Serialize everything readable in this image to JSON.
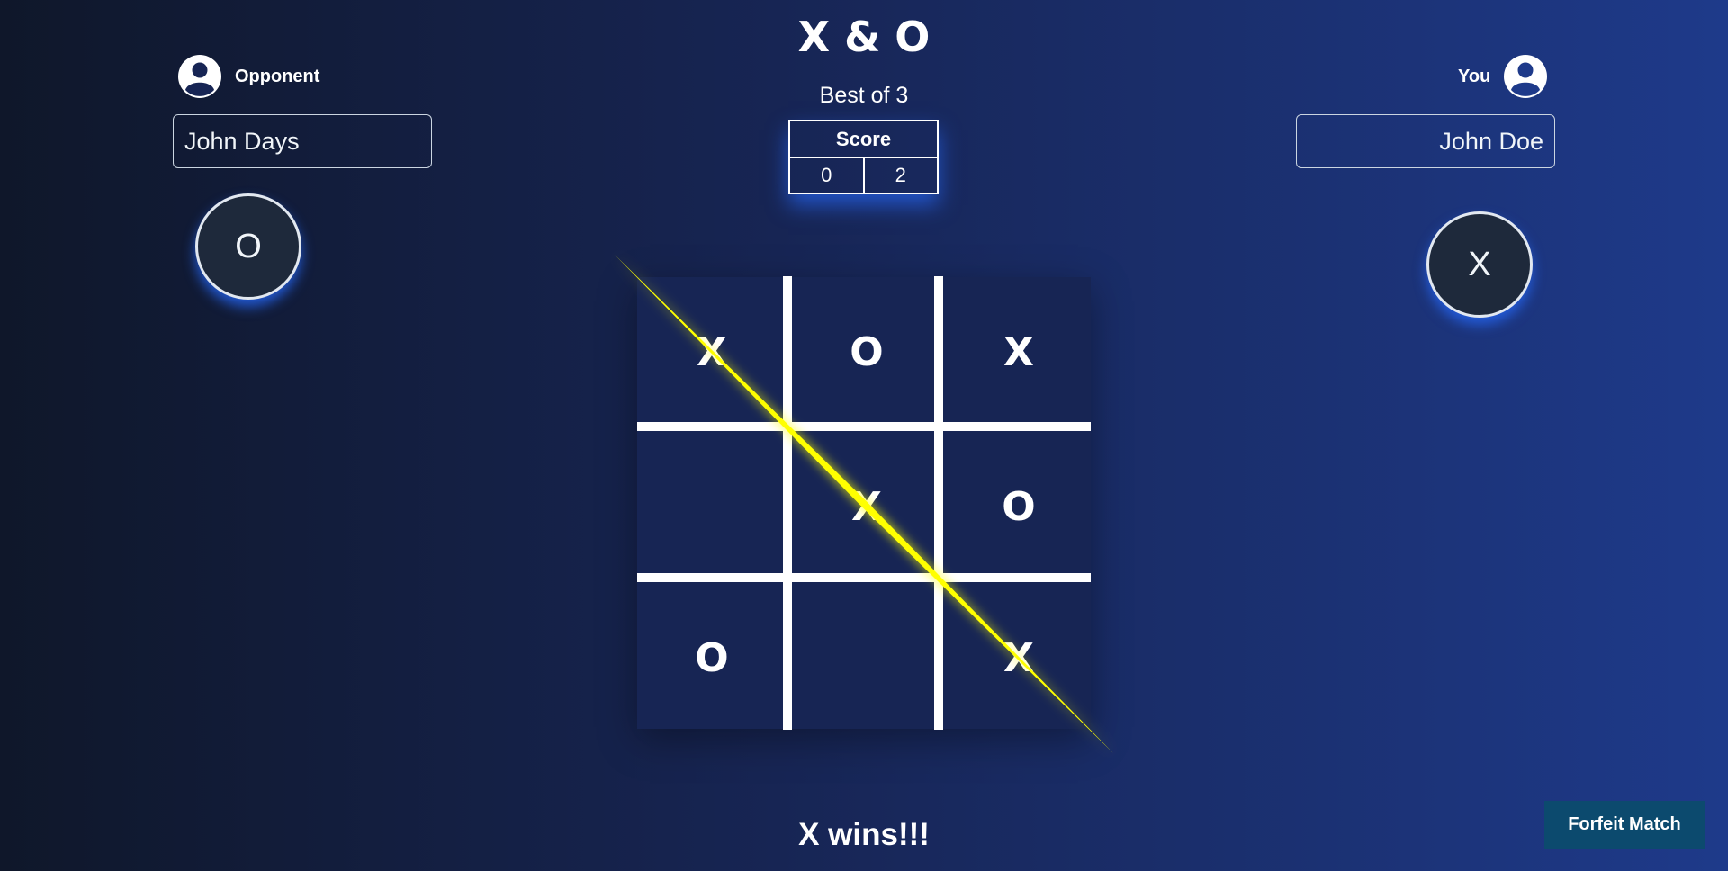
{
  "header": {
    "title": "X & O",
    "subtitle": "Best of 3"
  },
  "score": {
    "label": "Score",
    "opponent": "0",
    "you": "2"
  },
  "opponent": {
    "role_label": "Opponent",
    "name": "John Days",
    "symbol": "O",
    "icon": "user-circle-icon"
  },
  "player": {
    "role_label": "You",
    "name": "John Doe",
    "symbol": "X",
    "icon": "user-circle-icon"
  },
  "board": {
    "cells": [
      "X",
      "O",
      "X",
      "",
      "X",
      "O",
      "O",
      "",
      "X"
    ],
    "winning_line": [
      0,
      4,
      8
    ],
    "win_line_color": "#ffff00",
    "grid_color": "#ffffff"
  },
  "status": {
    "message": "X wins!!!"
  },
  "actions": {
    "forfeit_label": "Forfeit Match"
  }
}
